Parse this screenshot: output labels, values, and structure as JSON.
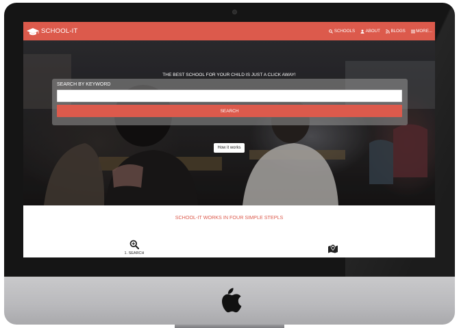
{
  "app": {
    "brand": "SCHOOL-IT",
    "accent_color": "#dc5a4c"
  },
  "navbar": {
    "links": [
      {
        "label": "SCHOOLS",
        "icon": "search-icon"
      },
      {
        "label": "ABOUT",
        "icon": "user-icon"
      },
      {
        "label": "BLOGS",
        "icon": "rss-icon"
      },
      {
        "label": "MORE...",
        "icon": "menu-icon"
      }
    ]
  },
  "hero": {
    "tagline": "THE BEST SCHOOL FOR YOUR CHILD IS JUST A CLICK AWAY!",
    "search": {
      "label": "SEARCH BY KEYWORD",
      "placeholder": "",
      "value": "",
      "button_label": "SEARCH"
    },
    "how_it_works_label": "How it works"
  },
  "steps": {
    "title": "SCHOOL-IT WORKS IN FOUR SIMPLE STEPLS",
    "items": [
      {
        "icon": "zoom-search-icon",
        "label": "1. SEARCH"
      },
      {
        "icon": "map-marker-icon",
        "label": ""
      }
    ]
  }
}
